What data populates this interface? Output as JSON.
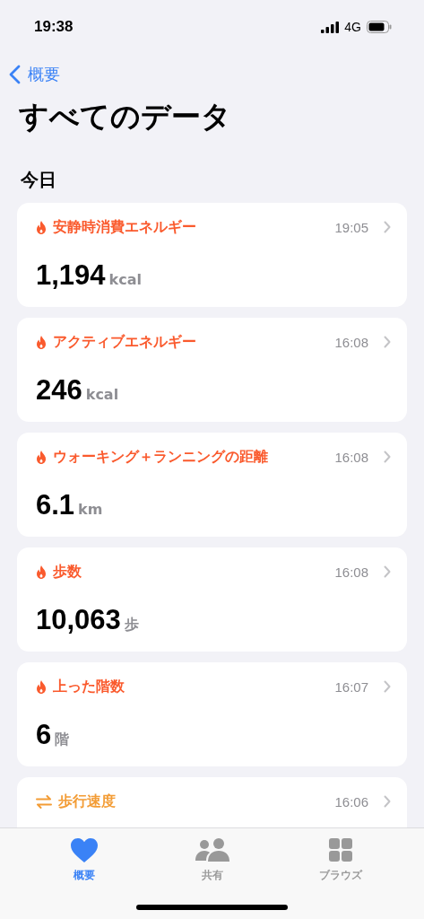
{
  "status_bar": {
    "time": "19:38",
    "network": "4G"
  },
  "nav": {
    "back_label": "概要"
  },
  "title": "すべてのデータ",
  "section": "今日",
  "cards": [
    {
      "kind": "flame",
      "color": "#fa5a2d",
      "label": "安静時消費エネルギー",
      "time": "19:05",
      "value": "1,194",
      "unit": "kcal"
    },
    {
      "kind": "flame",
      "color": "#fa5a2d",
      "label": "アクティブエネルギー",
      "time": "16:08",
      "value": "246",
      "unit": "kcal"
    },
    {
      "kind": "flame",
      "color": "#fa5a2d",
      "label": "ウォーキング＋ランニングの距離",
      "time": "16:08",
      "value": "6.1",
      "unit": "km"
    },
    {
      "kind": "flame",
      "color": "#fa5a2d",
      "label": "歩数",
      "time": "16:08",
      "value": "10,063",
      "unit": "歩"
    },
    {
      "kind": "flame",
      "color": "#fa5a2d",
      "label": "上った階数",
      "time": "16:07",
      "value": "6",
      "unit": "階"
    },
    {
      "kind": "arrows",
      "color": "#f39c35",
      "label": "歩行速度",
      "time": "16:06"
    }
  ],
  "tabs": [
    {
      "kind": "heart",
      "label": "概要",
      "selected": true
    },
    {
      "kind": "people",
      "label": "共有",
      "selected": false
    },
    {
      "kind": "grid",
      "label": "ブラウズ",
      "selected": false
    }
  ]
}
